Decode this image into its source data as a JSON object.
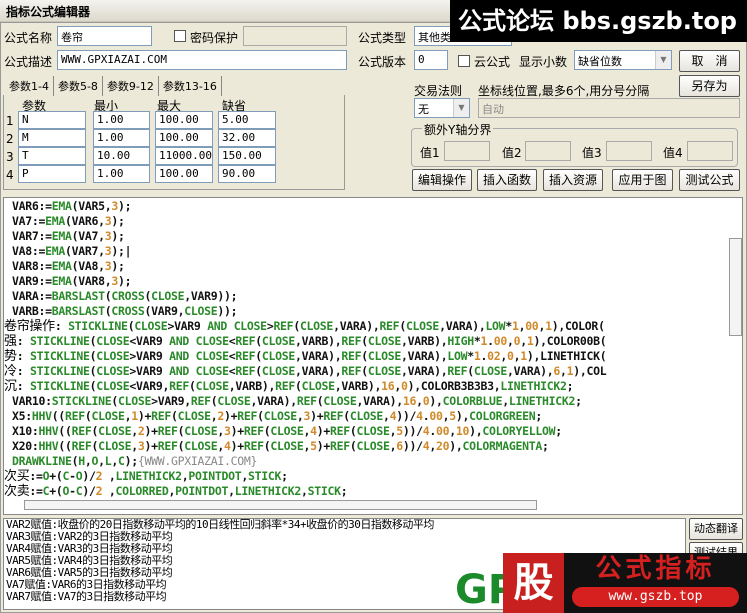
{
  "window": {
    "title": "指标公式编辑器"
  },
  "form": {
    "name_label": "公式名称",
    "name_value": "卷帘",
    "password_label": "密码保护",
    "desc_label": "公式描述",
    "desc_value": "WWW.GPXIAZAI.COM",
    "type_label": "公式类型",
    "type_value": "其他类型",
    "version_label": "公式版本",
    "version_value": "0",
    "cloud_label": "云公式",
    "decimals_label": "显示小数",
    "decimals_value": "缺省位数",
    "trade_rule_label": "交易法则",
    "trade_rule_value": "无",
    "axis_label": "坐标线位置,最多6个,用分号分隔",
    "axis_placeholder": "自动",
    "extra_y_label": "额外Y轴分界",
    "values": [
      "值1",
      "值2",
      "值3",
      "值4"
    ]
  },
  "buttons": {
    "cancel": "取　消",
    "save_as": "另存为",
    "edit_ops": "编辑操作",
    "insert_func": "插入函数",
    "insert_res": "插入资源",
    "apply_chart": "应用于图",
    "test_formula": "测试公式",
    "dynamic_translate": "动态翻译",
    "test_result": "测试结果"
  },
  "tabs": [
    "参数1-4",
    "参数5-8",
    "参数9-12",
    "参数13-16"
  ],
  "params": {
    "headers": [
      "参数",
      "最小",
      "最大",
      "缺省"
    ],
    "rows": [
      {
        "idx": "1",
        "name": "N",
        "min": "1.00",
        "max": "100.00",
        "def": "5.00"
      },
      {
        "idx": "2",
        "name": "M",
        "min": "1.00",
        "max": "100.00",
        "def": "32.00"
      },
      {
        "idx": "3",
        "name": "T",
        "min": "10.00",
        "max": "11000.00",
        "def": "150.00"
      },
      {
        "idx": "4",
        "name": "P",
        "min": "1.00",
        "max": "100.00",
        "def": "90.00"
      }
    ]
  },
  "code": [
    {
      "cn": "",
      "code": "VAR6:=EMA(VAR5,3);"
    },
    {
      "cn": "",
      "code": "VA7:=EMA(VAR6,3);"
    },
    {
      "cn": "",
      "code": "VAR7:=EMA(VA7,3);"
    },
    {
      "cn": "",
      "code": "VA8:=EMA(VAR7,3);|"
    },
    {
      "cn": "",
      "code": "VAR8:=EMA(VA8,3);"
    },
    {
      "cn": "",
      "code": "VAR9:=EMA(VAR8,3);"
    },
    {
      "cn": "",
      "code": "VARA:=BARSLAST(CROSS(CLOSE,VAR9));"
    },
    {
      "cn": "",
      "code": "VARB:=BARSLAST(CROSS(VAR9,CLOSE));"
    },
    {
      "cn": "卷帘操作",
      "code": ": STICKLINE(CLOSE>VAR9 AND CLOSE>REF(CLOSE,VARA),REF(CLOSE,VARA),LOW*1,00,1),COLOR("
    },
    {
      "cn": "强",
      "code": ": STICKLINE(CLOSE<VAR9 AND CLOSE<REF(CLOSE,VARB),REF(CLOSE,VARB),HIGH*1.00,0,1),COLOR00B("
    },
    {
      "cn": "势",
      "code": ": STICKLINE(CLOSE>VAR9 AND CLOSE<REF(CLOSE,VARA),REF(CLOSE,VARA),LOW*1.02,0,1),LINETHICK("
    },
    {
      "cn": "冷",
      "code": ": STICKLINE(CLOSE>VAR9 AND CLOSE<REF(CLOSE,VARA),REF(CLOSE,VARA),REF(CLOSE,VARA),6,1),COL"
    },
    {
      "cn": "沉",
      "code": ": STICKLINE(CLOSE<VAR9,REF(CLOSE,VARB),REF(CLOSE,VARB),16,0),COLORB3B3B3,LINETHICK2;"
    },
    {
      "cn": "",
      "code": "VAR10:STICKLINE(CLOSE>VAR9,REF(CLOSE,VARA),REF(CLOSE,VARA),16,0),COLORBLUE,LINETHICK2;"
    },
    {
      "cn": "",
      "code": "X5:HHV((REF(CLOSE,1)+REF(CLOSE,2)+REF(CLOSE,3)+REF(CLOSE,4))/4.00,5),COLORGREEN;"
    },
    {
      "cn": "",
      "code": "X10:HHV((REF(CLOSE,2)+REF(CLOSE,3)+REF(CLOSE,4)+REF(CLOSE,5))/4.00,10),COLORYELLOW;"
    },
    {
      "cn": "",
      "code": "X20:HHV((REF(CLOSE,3)+REF(CLOSE,4)+REF(CLOSE,5)+REF(CLOSE,6))/4,20),COLORMAGENTA;"
    },
    {
      "cn": "",
      "code": "DRAWKLINE(H,O,L,C);{WWW.GPXIAZAI.COM}"
    },
    {
      "cn": "次买",
      "code": ":=O+(C-O)/2 ,LINETHICK2,POINTDOT,STICK;"
    },
    {
      "cn": "次卖",
      "code": ":=C+(O-C)/2 ,COLORRED,POINTDOT,LINETHICK2,STICK;"
    }
  ],
  "output": [
    "VAR2赋值:收盘价的20日指数移动平均的10日线性回归斜率*34+收盘价的30日指数移动平均",
    "VAR3赋值:VAR2的3日指数移动平均",
    "VAR4赋值:VAR3的3日指数移动平均",
    "VAR5赋值:VAR4的3日指数移动平均",
    "VAR6赋值:VAR5的3日指数移动平均",
    "VA7赋值:VAR6的3日指数移动平均",
    "VAR7赋值:VA7的3日指数移动平均"
  ],
  "watermarks": {
    "top": "公式论坛 bbs.gszb.top",
    "logo_gp": "GP",
    "logo_gu": "股",
    "logo_title": "公式指标",
    "logo_url": "www.gszb.top"
  },
  "colors": {
    "function": "#2a8a2a",
    "number": "#d08a2a",
    "comment": "#888888",
    "logo_red": "#c8201e"
  }
}
